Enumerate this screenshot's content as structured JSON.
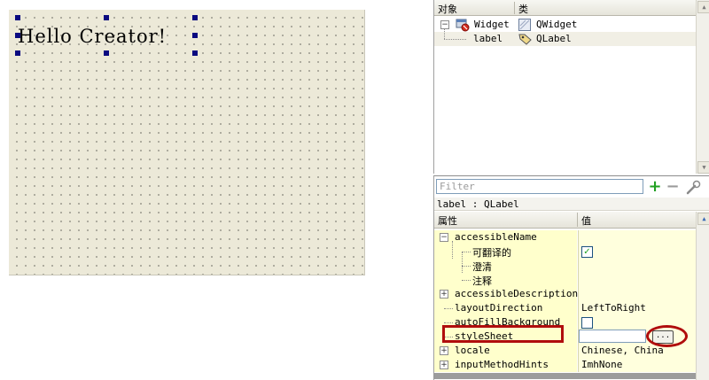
{
  "canvas": {
    "label_text": "Hello Creator!"
  },
  "object_inspector": {
    "headers": {
      "object": "对象",
      "class": "类"
    },
    "rows": [
      {
        "name": "Widget",
        "class": "QWidget"
      },
      {
        "name": "label",
        "class": "QLabel"
      }
    ]
  },
  "property_editor": {
    "filter_placeholder": "Filter",
    "object_line": "label : QLabel",
    "headers": {
      "property": "属性",
      "value": "值"
    },
    "rows": {
      "accessibleName": {
        "name": "accessibleName",
        "value": ""
      },
      "translatable": {
        "name": "可翻译的",
        "checked": true
      },
      "disambiguation": {
        "name": "澄清",
        "value": ""
      },
      "comment": {
        "name": "注释",
        "value": ""
      },
      "accessibleDescription": {
        "name": "accessibleDescription",
        "value": ""
      },
      "layoutDirection": {
        "name": "layoutDirection",
        "value": "LeftToRight"
      },
      "autoFillBackground": {
        "name": "autoFillBackground",
        "checked": false
      },
      "styleSheet": {
        "name": "styleSheet",
        "value": "",
        "button": "..."
      },
      "locale": {
        "name": "locale",
        "value": "Chinese, China"
      },
      "inputMethodHints": {
        "name": "inputMethodHints",
        "value": "ImhNone"
      }
    }
  },
  "colors": {
    "highlight": "#b00d0d",
    "property_bg": "#ffffcc",
    "canvas_bg": "#ece9d8"
  }
}
